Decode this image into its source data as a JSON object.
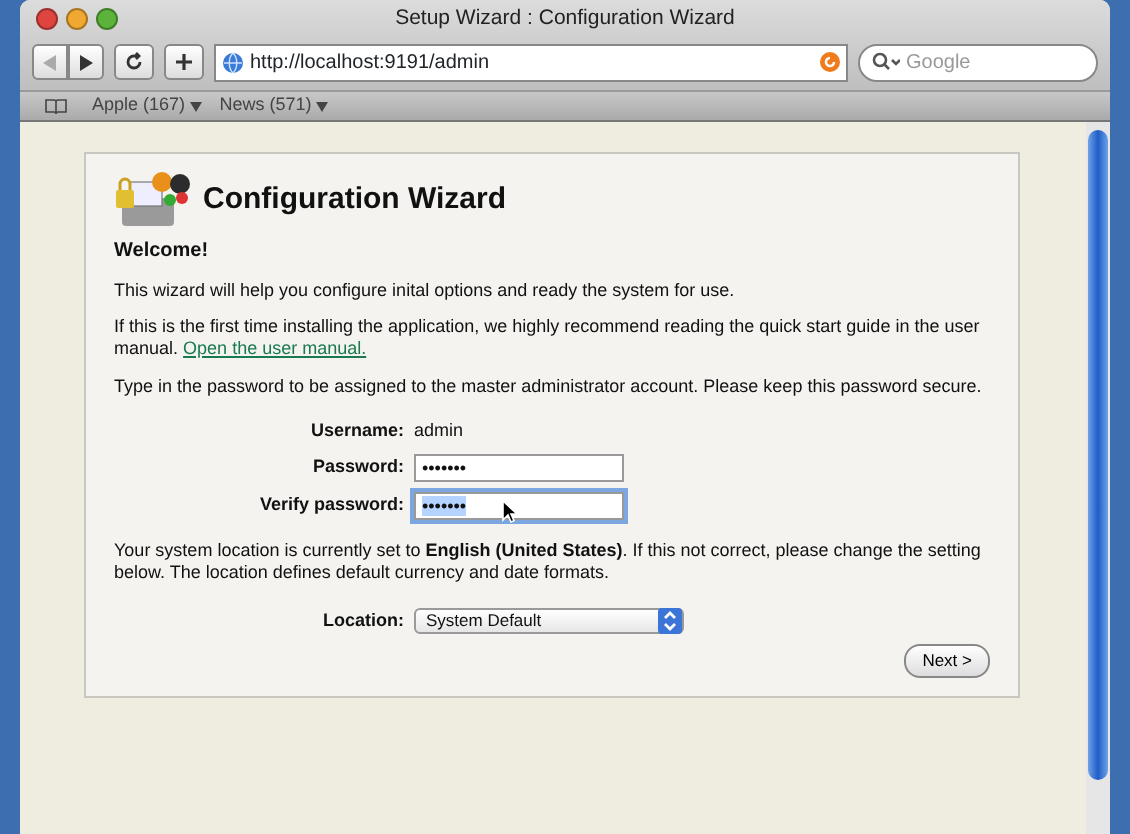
{
  "window": {
    "title": "Setup Wizard : Configuration Wizard"
  },
  "toolbar": {
    "address": "http://localhost:9191/admin",
    "search_placeholder": "Google"
  },
  "bookmarks": [
    "Apple (167)",
    "News (571)"
  ],
  "wizard": {
    "heading": "Configuration Wizard",
    "welcome": "Welcome!",
    "intro": "This wizard will help you configure inital options and ready the system for use.",
    "manual_text": "If this is the first time installing the application, we highly recommend reading the quick start guide in the user manual.",
    "manual_link": "Open the user manual.",
    "password_text": "Type in the password to be assigned to the master administrator account. Please keep this password secure.",
    "fields": [
      {
        "kind": "static",
        "label": "Username:",
        "value": "admin"
      },
      {
        "kind": "input",
        "label": "Password:",
        "value": "•••••••",
        "focused": false
      },
      {
        "kind": "input",
        "label": "Verify password:",
        "value": "•••••••",
        "focused": true
      }
    ],
    "location_text": "Your system location is currently set to **English (United States)**. If this not correct, please change the setting below. The location defines default currency and date formats.",
    "location": {
      "label": "Location:",
      "value": "System Default"
    },
    "next": "Next >"
  }
}
